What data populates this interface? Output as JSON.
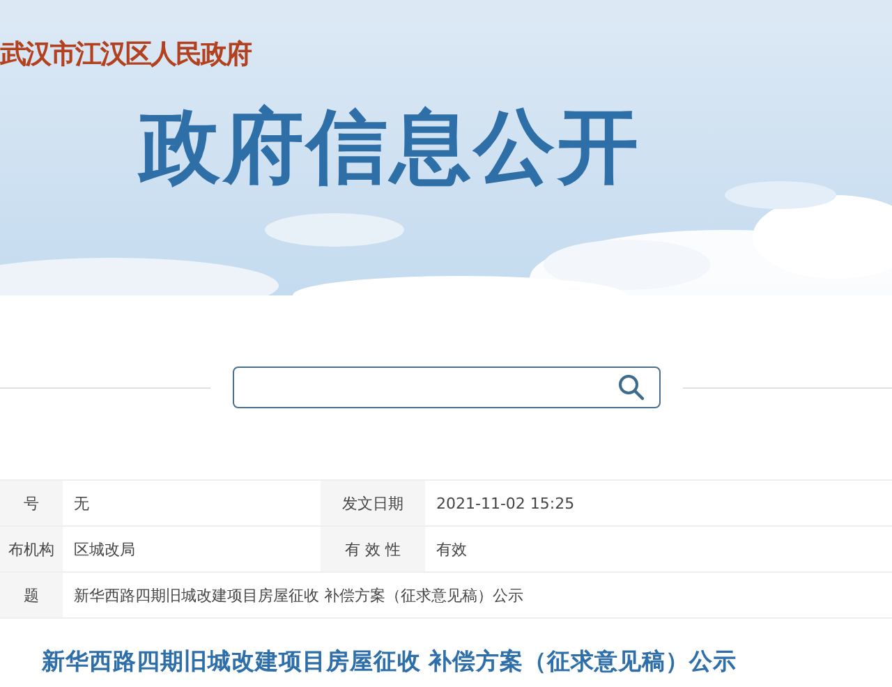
{
  "banner": {
    "org_name": "武汉市江汉区人民政府",
    "title": "政府信息公开"
  },
  "info_table": {
    "rows": [
      {
        "fields": [
          {
            "label": "号",
            "value": "无"
          },
          {
            "label": "发文日期",
            "value": "2021-11-02 15:25"
          }
        ]
      },
      {
        "fields": [
          {
            "label": "布机构",
            "value": "区城改局"
          },
          {
            "label": "有 效 性",
            "value": "有效"
          }
        ]
      },
      {
        "fields": [
          {
            "label": "题",
            "value": "新华西路四期旧城改建项目房屋征收 补偿方案（征求意见稿）公示"
          }
        ]
      }
    ]
  },
  "article_title": "新华西路四期旧城改建项目房屋征收 补偿方案（征求意见稿）公示"
}
